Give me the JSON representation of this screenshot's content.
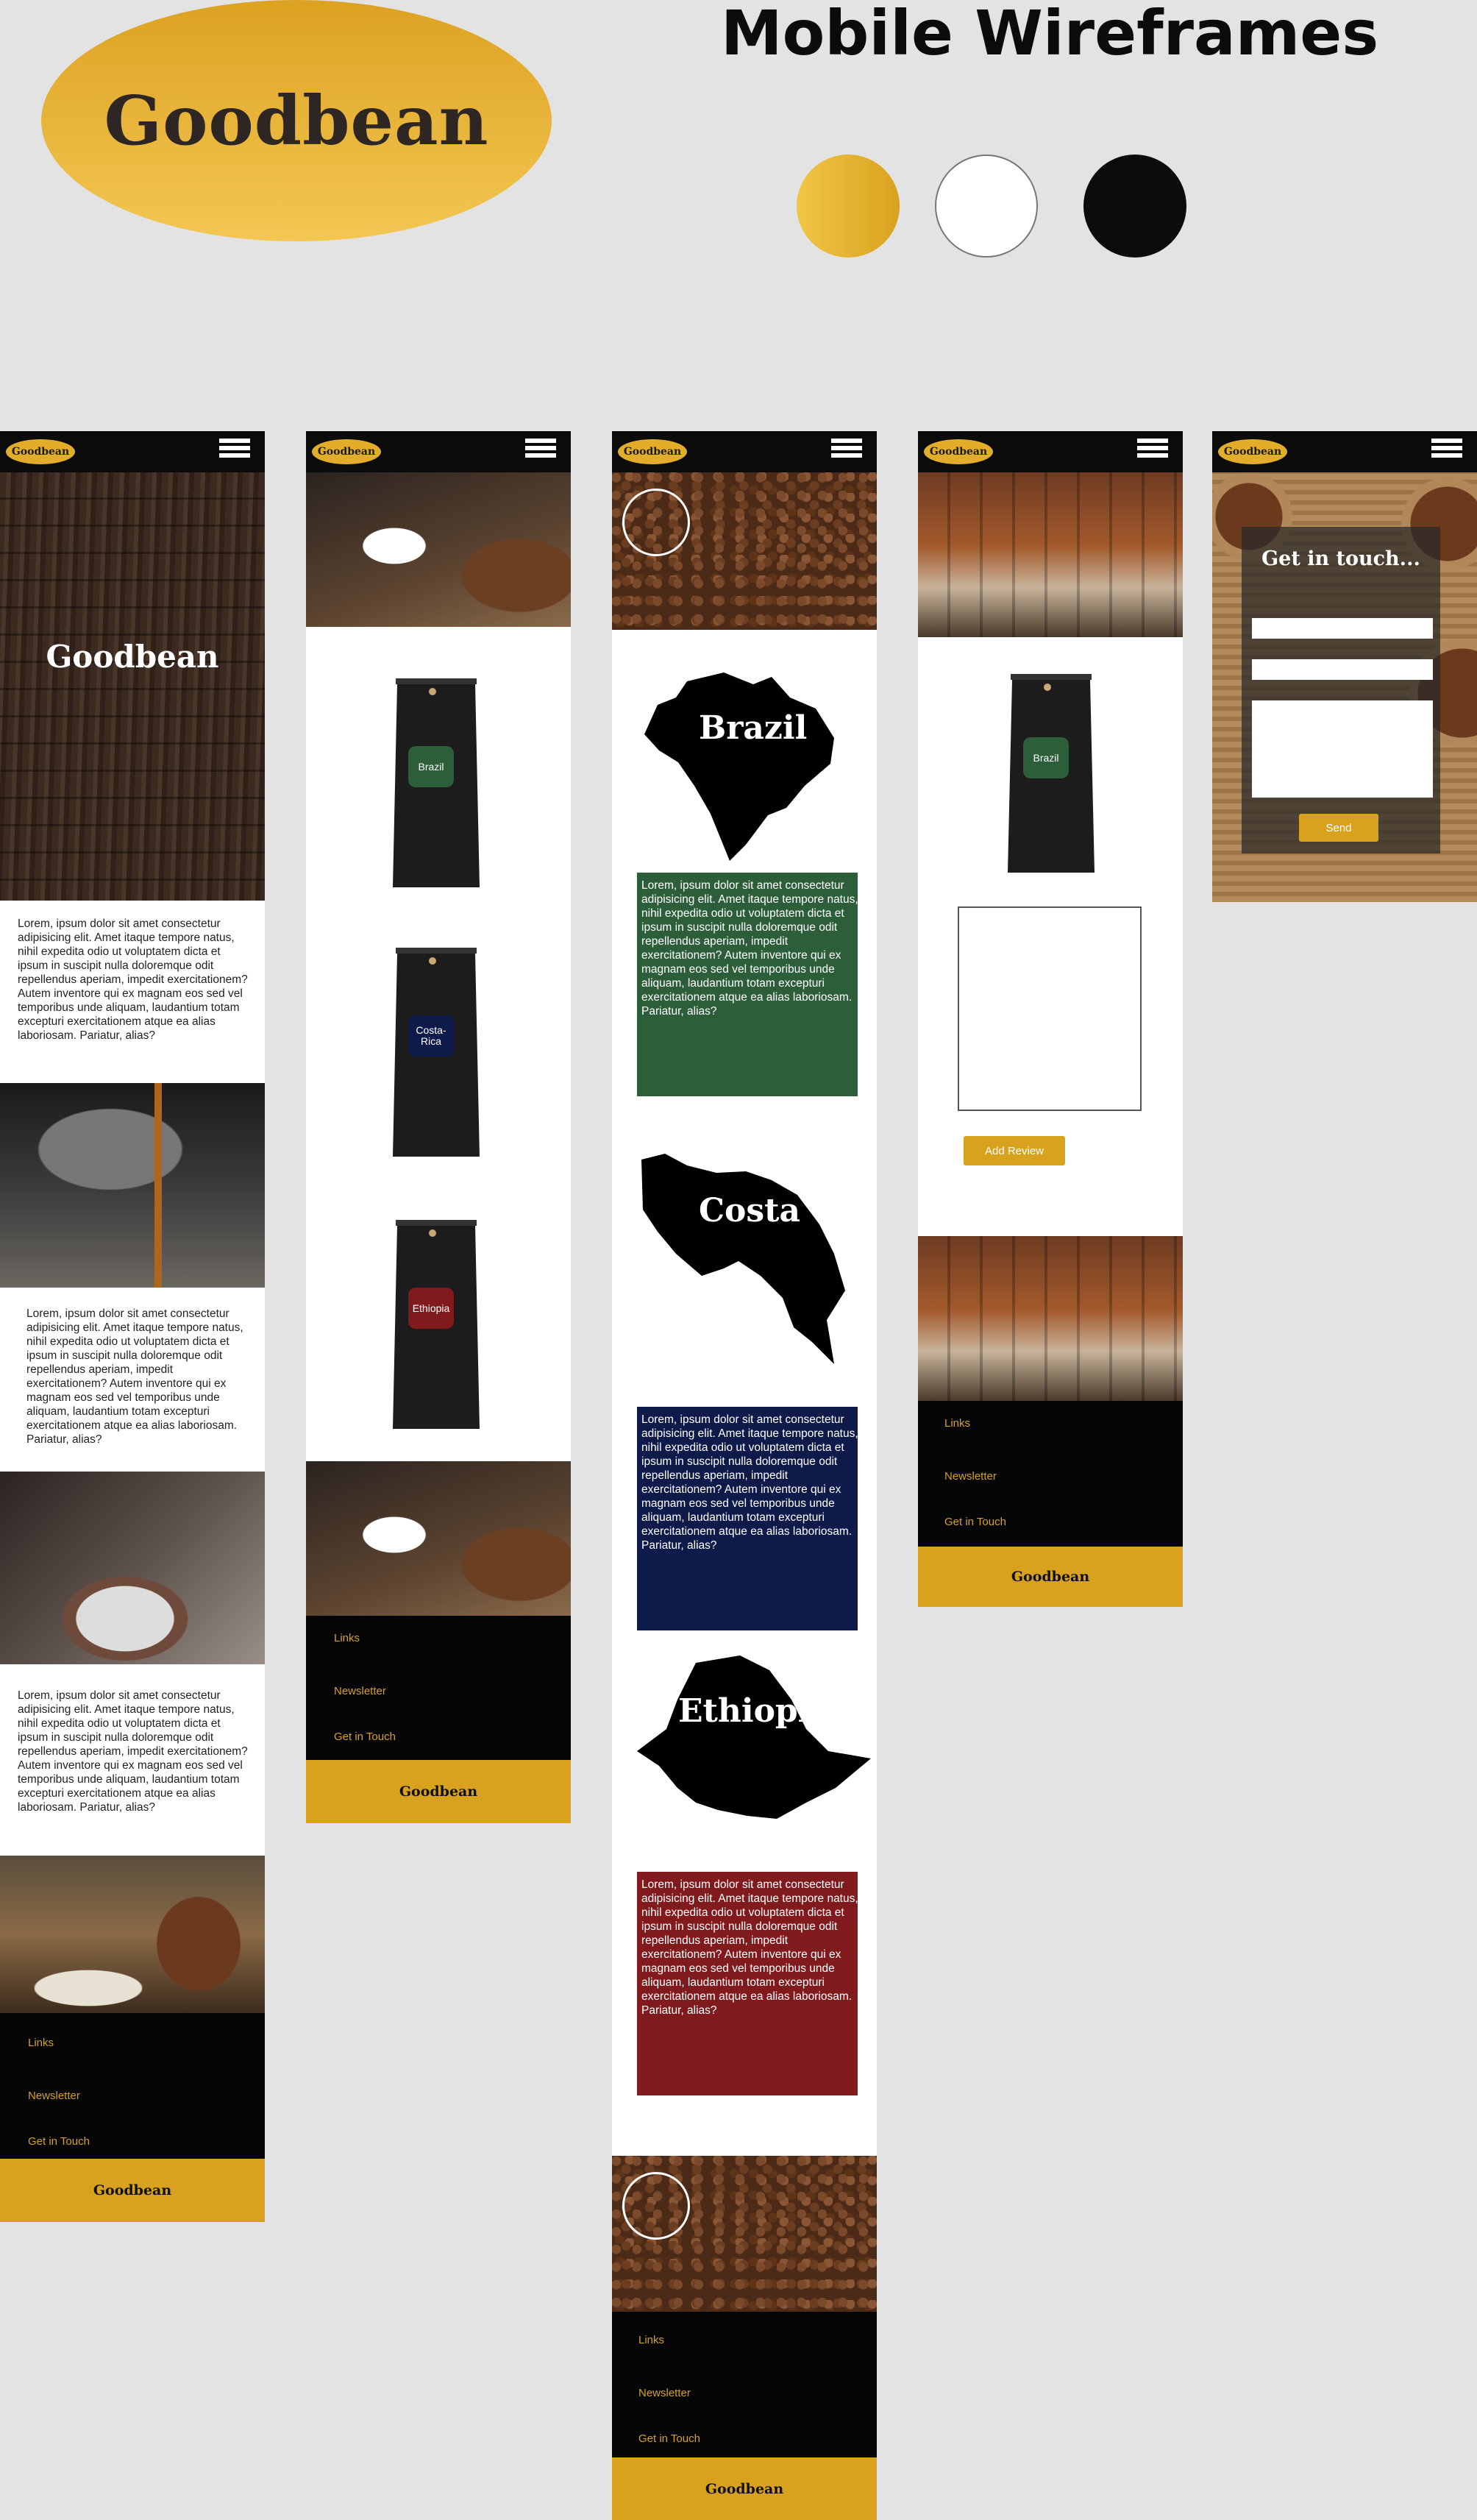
{
  "brand": "Goodbean",
  "header": {
    "title": "Mobile Wireframes"
  },
  "colors": {
    "gold": "#d8a21f",
    "white": "#ffffff",
    "black": "#0b0b0b"
  },
  "lorem": "Lorem, ipsum dolor sit amet consectetur adipisicing elit. Amet itaque tempore natus, nihil expedita odio ut voluptatem dicta et ipsum in suscipit nulla doloremque odit repellendus aperiam, impedit exercitationem? Autem inventore qui ex magnam eos sed vel temporibus unde aliquam, laudantium totam excepturi exercitationem atque ea alias laboriosam. Pariatur, alias?",
  "footer": {
    "links": "Links",
    "newsletter": "Newsletter",
    "contact": "Get in Touch",
    "brand": "Goodbean"
  },
  "products": [
    "Brazil",
    "Costa-Rica",
    "Ethiopia"
  ],
  "countries": [
    {
      "name": "Brazil",
      "color": "#2c5e3a"
    },
    {
      "name": "Costa",
      "color": "#0d1a4a"
    },
    {
      "name": "Ethiopia",
      "color": "#801a1d"
    }
  ],
  "product_page": {
    "bag_label": "Brazil",
    "add_review": "Add Review"
  },
  "contact": {
    "title": "Get in touch...",
    "send": "Send"
  }
}
